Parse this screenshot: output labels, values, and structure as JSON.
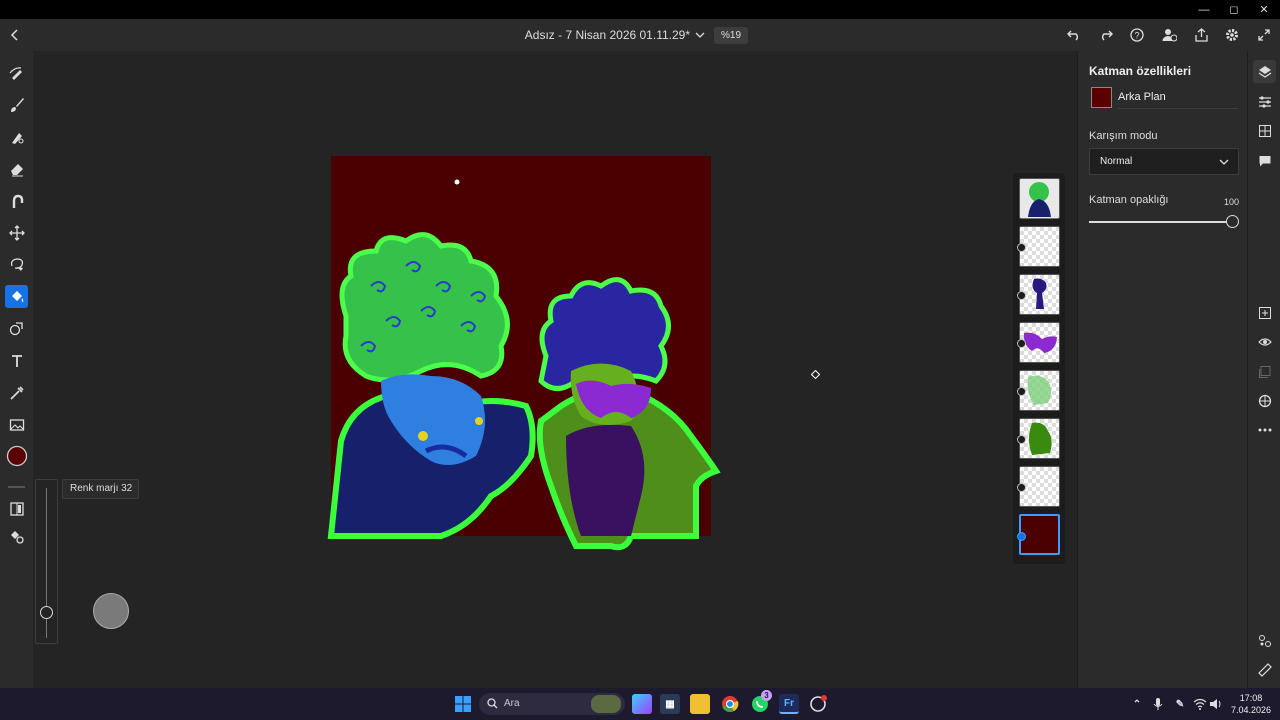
{
  "window": {
    "minimize": "—",
    "maximize": "◻",
    "close": "✕"
  },
  "header": {
    "title": "Adsız - 7 Nisan 2026 01.11.29*",
    "zoom": "%19"
  },
  "tool_options": {
    "tooltip": "Renk marjı 32",
    "slider_value": 0
  },
  "colors": {
    "accent": "#1473e6",
    "current_color": "#5a0000",
    "canvas_bg": "#4a0000"
  },
  "layers": {
    "count": 8,
    "selected_index": 7
  },
  "properties": {
    "heading": "Katman özellikleri",
    "layer_name": "Arka Plan",
    "blend_label": "Karışım modu",
    "blend_value": "Normal",
    "opacity_label": "Katman opaklığı",
    "opacity_value": "100",
    "opacity_fraction": 1.0
  },
  "taskbar": {
    "search_placeholder": "Ara",
    "time": "17:08",
    "date": "7.04.2026",
    "whatsapp_badge": "3"
  }
}
